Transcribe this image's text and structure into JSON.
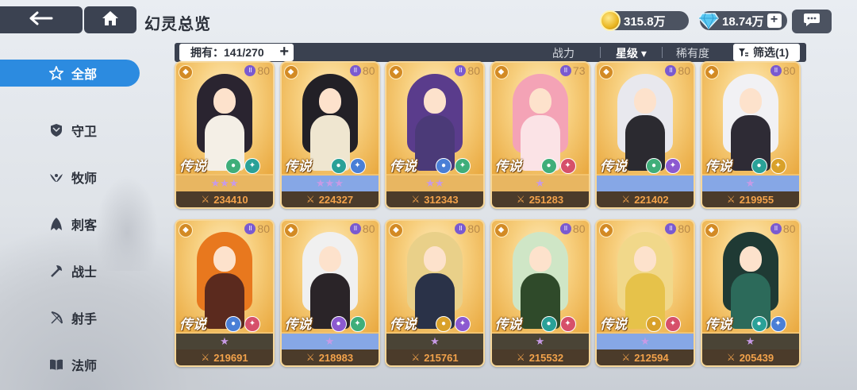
{
  "header": {
    "title": "幻灵总览",
    "gold": "315.8万",
    "gems": "18.74万",
    "plus": "+"
  },
  "sidebar": {
    "items": [
      {
        "label": "全部",
        "icon": "star-outline-icon",
        "active": true
      },
      {
        "label": "守卫",
        "icon": "shield-icon",
        "active": false
      },
      {
        "label": "牧师",
        "icon": "wings-icon",
        "active": false
      },
      {
        "label": "刺客",
        "icon": "assassin-hood-icon",
        "active": false
      },
      {
        "label": "战士",
        "icon": "axe-icon",
        "active": false
      },
      {
        "label": "射手",
        "icon": "bow-icon",
        "active": false
      },
      {
        "label": "法师",
        "icon": "book-icon",
        "active": false
      }
    ]
  },
  "filterbar": {
    "owned": "拥有：141/270",
    "owned_plus": "+",
    "power": "战力",
    "star": "星级",
    "star_arrow": "▾",
    "rarity": "稀有度",
    "filter": "筛选(1)"
  },
  "cards": [
    {
      "rarity": "传说",
      "level": "80",
      "stars": "★★★",
      "strip": "gold",
      "power": "234410",
      "class_color": "#d38a24",
      "hair": "#2a2430",
      "body": "#f4efe6",
      "elems": [
        "#3fae7a",
        "#2aa198"
      ]
    },
    {
      "rarity": "传说",
      "level": "80",
      "stars": "★★★",
      "strip": "blue",
      "power": "224327",
      "class_color": "#d38a24",
      "hair": "#222026",
      "body": "#efe6d0",
      "elems": [
        "#2aa198",
        "#4a7fd6"
      ]
    },
    {
      "rarity": "传说",
      "level": "80",
      "stars": "★★",
      "strip": "gold",
      "power": "312343",
      "class_color": "#d38a24",
      "hair": "#5a3c8c",
      "body": "#4b3a78",
      "elems": [
        "#4a7fd6",
        "#3fae7a"
      ]
    },
    {
      "rarity": "传说",
      "level": "73",
      "stars": "★",
      "strip": "gold",
      "power": "251283",
      "class_color": "#d38a24",
      "hair": "#f4a3b6",
      "body": "#fbe3e6",
      "elems": [
        "#3fae7a",
        "#d6506a"
      ]
    },
    {
      "rarity": "传说",
      "level": "80",
      "stars": "",
      "strip": "blue",
      "power": "221402",
      "class_color": "#d38a24",
      "hair": "#e8e8ee",
      "body": "#2b2a30",
      "elems": [
        "#3fae7a",
        "#8c5ad0"
      ]
    },
    {
      "rarity": "传说",
      "level": "80",
      "stars": "★",
      "strip": "blue",
      "power": "219955",
      "class_color": "#d38a24",
      "hair": "#f1f1f4",
      "body": "#2e2b35",
      "elems": [
        "#2aa198",
        "#d9a12a"
      ]
    },
    {
      "rarity": "传说",
      "level": "80",
      "stars": "★",
      "strip": "dark",
      "power": "219691",
      "class_color": "#d38a24",
      "hair": "#e8781e",
      "body": "#5b2a1e",
      "elems": [
        "#4a7fd6",
        "#d6506a"
      ]
    },
    {
      "rarity": "传说",
      "level": "80",
      "stars": "★",
      "strip": "blue",
      "power": "218983",
      "class_color": "#d38a24",
      "hair": "#f0f0f0",
      "body": "#2a2428",
      "elems": [
        "#8c5ad0",
        "#3fae7a"
      ]
    },
    {
      "rarity": "传说",
      "level": "80",
      "stars": "★",
      "strip": "dark",
      "power": "215761",
      "class_color": "#d38a24",
      "hair": "#e9d089",
      "body": "#2a3248",
      "elems": [
        "#d9a12a",
        "#8c5ad0"
      ]
    },
    {
      "rarity": "传说",
      "level": "80",
      "stars": "★",
      "strip": "dark",
      "power": "215532",
      "class_color": "#d38a24",
      "hair": "#cfe6c6",
      "body": "#2f4a2a",
      "elems": [
        "#2aa198",
        "#d6506a"
      ]
    },
    {
      "rarity": "传说",
      "level": "80",
      "stars": "★",
      "strip": "blue",
      "power": "212594",
      "class_color": "#d38a24",
      "hair": "#f1d88a",
      "body": "#e6c24a",
      "elems": [
        "#d9a12a",
        "#d6506a"
      ]
    },
    {
      "rarity": "传说",
      "level": "80",
      "stars": "★",
      "strip": "dark",
      "power": "205439",
      "class_color": "#d38a24",
      "hair": "#1f3a34",
      "body": "#2c6a5a",
      "elems": [
        "#2aa198",
        "#4a7fd6"
      ]
    }
  ]
}
